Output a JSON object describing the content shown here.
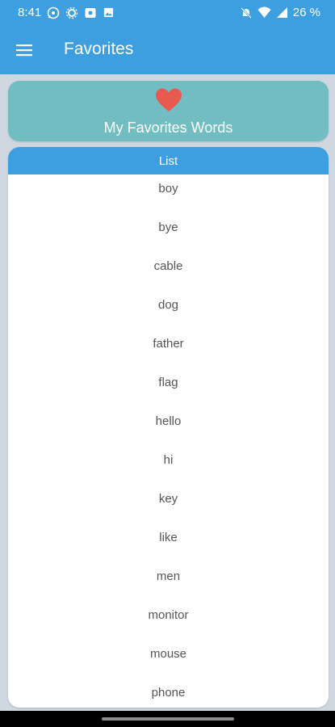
{
  "status_bar": {
    "time": "8:41",
    "battery": "26 %",
    "left_icons": [
      "whatsapp-icon",
      "settings-icon",
      "screen-record-icon",
      "image-icon"
    ],
    "right_icons": [
      "mute-icon",
      "wifi-icon",
      "signal-icon",
      "battery-icon"
    ]
  },
  "app_bar": {
    "title": "Favorites",
    "menu_icon": "menu-icon"
  },
  "header_card": {
    "icon": "heart-icon",
    "title": "My Favorites Words"
  },
  "list": {
    "header": "List",
    "words": [
      "boy",
      "bye",
      "cable",
      "dog",
      "father",
      "flag",
      "hello",
      "hi",
      "key",
      "like",
      "men",
      "monitor",
      "mouse",
      "phone"
    ]
  },
  "colors": {
    "primary": "#3d9ee0",
    "header_card": "#72bdc1",
    "heart": "#e85a4f",
    "background": "#cfd8e0",
    "word_text": "#555555"
  }
}
